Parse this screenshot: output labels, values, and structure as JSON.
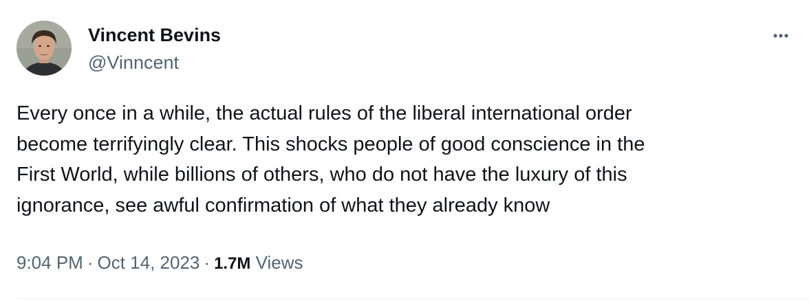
{
  "author": {
    "name": "Vincent Bevins",
    "handle": "@Vinncent"
  },
  "tweet": {
    "text_lines": [
      "Every once in a while, the actual rules of the liberal international order",
      "become terrifyingly clear. This shocks people of good conscience in the",
      "First World, while billions of others, who do not have the luxury of this",
      "ignorance, see awful confirmation of what they already know"
    ]
  },
  "meta": {
    "time": "9:04 PM",
    "separator": "·",
    "date": "Oct 14, 2023",
    "views_count": "1.7M",
    "views_label": "Views"
  },
  "icons": {
    "more": "more-horizontal-icon",
    "avatar": "profile-photo"
  },
  "colors": {
    "text_primary": "#0f1419",
    "text_secondary": "#536471",
    "divider": "#eff3f4"
  }
}
